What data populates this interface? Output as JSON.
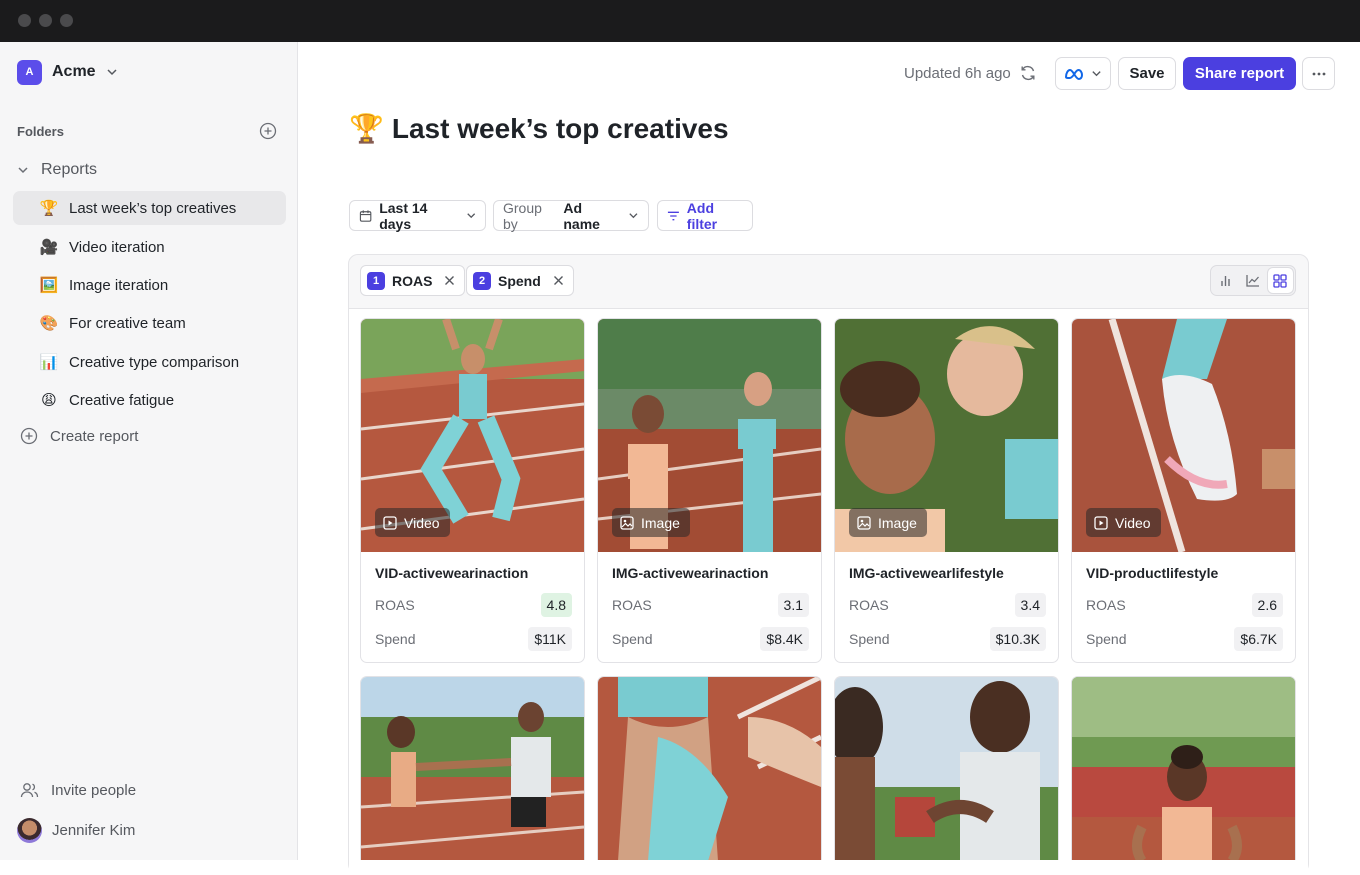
{
  "workspace": {
    "initial": "A",
    "name": "Acme"
  },
  "sidebar": {
    "folders_label": "Folders",
    "reports_label": "Reports",
    "items": [
      {
        "emoji": "🏆",
        "label": "Last week’s top creatives"
      },
      {
        "emoji": "🎥",
        "label": "Video iteration"
      },
      {
        "emoji": "🖼️",
        "label": "Image iteration"
      },
      {
        "emoji": "🎨",
        "label": "For creative team"
      },
      {
        "emoji": "📊",
        "label": "Creative type comparison"
      },
      {
        "emoji": "😩",
        "label": "Creative fatigue"
      }
    ],
    "create_label": "Create report",
    "invite_label": "Invite people",
    "user_name": "Jennifer Kim"
  },
  "topbar": {
    "updated": "Updated 6h ago",
    "save_label": "Save",
    "share_label": "Share report"
  },
  "page": {
    "emoji": "🏆",
    "title": "Last week’s top creatives"
  },
  "filters": {
    "date_range": "Last 14 days",
    "group_by_prefix": "Group by",
    "group_by_value": "Ad name",
    "add_filter": "Add filter"
  },
  "metrics": [
    {
      "num": "1",
      "label": "ROAS"
    },
    {
      "num": "2",
      "label": "Spend"
    }
  ],
  "cards": [
    {
      "type": "Video",
      "name": "VID-activewearinaction",
      "roas_label": "ROAS",
      "roas": "4.8",
      "spend_label": "Spend",
      "spend": "$11K"
    },
    {
      "type": "Image",
      "name": "IMG-activewearinaction",
      "roas_label": "ROAS",
      "roas": "3.1",
      "spend_label": "Spend",
      "spend": "$8.4K"
    },
    {
      "type": "Image",
      "name": "IMG-activewearlifestyle",
      "roas_label": "ROAS",
      "roas": "3.4",
      "spend_label": "Spend",
      "spend": "$10.3K"
    },
    {
      "type": "Video",
      "name": "VID-productlifestyle",
      "roas_label": "ROAS",
      "roas": "2.6",
      "spend_label": "Spend",
      "spend": "$6.7K"
    }
  ],
  "colors": {
    "accent": "#4b3fe0",
    "good": "#dff3e3"
  }
}
